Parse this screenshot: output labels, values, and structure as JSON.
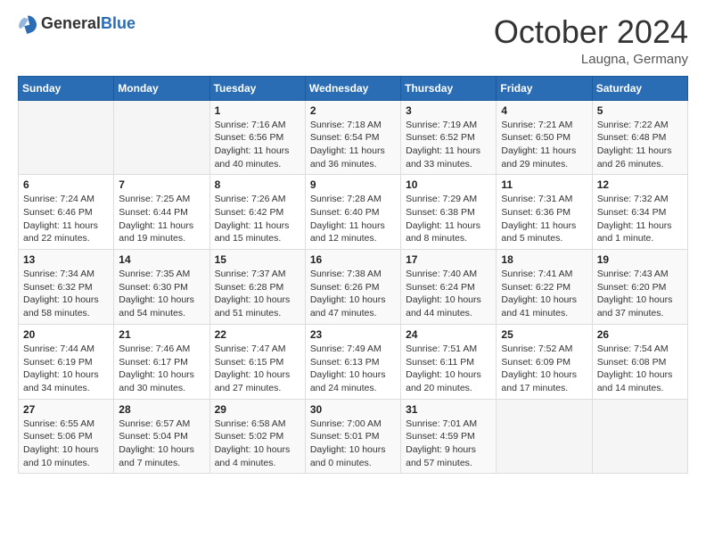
{
  "logo": {
    "general": "General",
    "blue": "Blue"
  },
  "title": "October 2024",
  "location": "Laugna, Germany",
  "days_of_week": [
    "Sunday",
    "Monday",
    "Tuesday",
    "Wednesday",
    "Thursday",
    "Friday",
    "Saturday"
  ],
  "weeks": [
    [
      {
        "day": "",
        "sunrise": "",
        "sunset": "",
        "daylight": "",
        "empty": true
      },
      {
        "day": "",
        "sunrise": "",
        "sunset": "",
        "daylight": "",
        "empty": true
      },
      {
        "day": "1",
        "sunrise": "Sunrise: 7:16 AM",
        "sunset": "Sunset: 6:56 PM",
        "daylight": "Daylight: 11 hours and 40 minutes."
      },
      {
        "day": "2",
        "sunrise": "Sunrise: 7:18 AM",
        "sunset": "Sunset: 6:54 PM",
        "daylight": "Daylight: 11 hours and 36 minutes."
      },
      {
        "day": "3",
        "sunrise": "Sunrise: 7:19 AM",
        "sunset": "Sunset: 6:52 PM",
        "daylight": "Daylight: 11 hours and 33 minutes."
      },
      {
        "day": "4",
        "sunrise": "Sunrise: 7:21 AM",
        "sunset": "Sunset: 6:50 PM",
        "daylight": "Daylight: 11 hours and 29 minutes."
      },
      {
        "day": "5",
        "sunrise": "Sunrise: 7:22 AM",
        "sunset": "Sunset: 6:48 PM",
        "daylight": "Daylight: 11 hours and 26 minutes."
      }
    ],
    [
      {
        "day": "6",
        "sunrise": "Sunrise: 7:24 AM",
        "sunset": "Sunset: 6:46 PM",
        "daylight": "Daylight: 11 hours and 22 minutes."
      },
      {
        "day": "7",
        "sunrise": "Sunrise: 7:25 AM",
        "sunset": "Sunset: 6:44 PM",
        "daylight": "Daylight: 11 hours and 19 minutes."
      },
      {
        "day": "8",
        "sunrise": "Sunrise: 7:26 AM",
        "sunset": "Sunset: 6:42 PM",
        "daylight": "Daylight: 11 hours and 15 minutes."
      },
      {
        "day": "9",
        "sunrise": "Sunrise: 7:28 AM",
        "sunset": "Sunset: 6:40 PM",
        "daylight": "Daylight: 11 hours and 12 minutes."
      },
      {
        "day": "10",
        "sunrise": "Sunrise: 7:29 AM",
        "sunset": "Sunset: 6:38 PM",
        "daylight": "Daylight: 11 hours and 8 minutes."
      },
      {
        "day": "11",
        "sunrise": "Sunrise: 7:31 AM",
        "sunset": "Sunset: 6:36 PM",
        "daylight": "Daylight: 11 hours and 5 minutes."
      },
      {
        "day": "12",
        "sunrise": "Sunrise: 7:32 AM",
        "sunset": "Sunset: 6:34 PM",
        "daylight": "Daylight: 11 hours and 1 minute."
      }
    ],
    [
      {
        "day": "13",
        "sunrise": "Sunrise: 7:34 AM",
        "sunset": "Sunset: 6:32 PM",
        "daylight": "Daylight: 10 hours and 58 minutes."
      },
      {
        "day": "14",
        "sunrise": "Sunrise: 7:35 AM",
        "sunset": "Sunset: 6:30 PM",
        "daylight": "Daylight: 10 hours and 54 minutes."
      },
      {
        "day": "15",
        "sunrise": "Sunrise: 7:37 AM",
        "sunset": "Sunset: 6:28 PM",
        "daylight": "Daylight: 10 hours and 51 minutes."
      },
      {
        "day": "16",
        "sunrise": "Sunrise: 7:38 AM",
        "sunset": "Sunset: 6:26 PM",
        "daylight": "Daylight: 10 hours and 47 minutes."
      },
      {
        "day": "17",
        "sunrise": "Sunrise: 7:40 AM",
        "sunset": "Sunset: 6:24 PM",
        "daylight": "Daylight: 10 hours and 44 minutes."
      },
      {
        "day": "18",
        "sunrise": "Sunrise: 7:41 AM",
        "sunset": "Sunset: 6:22 PM",
        "daylight": "Daylight: 10 hours and 41 minutes."
      },
      {
        "day": "19",
        "sunrise": "Sunrise: 7:43 AM",
        "sunset": "Sunset: 6:20 PM",
        "daylight": "Daylight: 10 hours and 37 minutes."
      }
    ],
    [
      {
        "day": "20",
        "sunrise": "Sunrise: 7:44 AM",
        "sunset": "Sunset: 6:19 PM",
        "daylight": "Daylight: 10 hours and 34 minutes."
      },
      {
        "day": "21",
        "sunrise": "Sunrise: 7:46 AM",
        "sunset": "Sunset: 6:17 PM",
        "daylight": "Daylight: 10 hours and 30 minutes."
      },
      {
        "day": "22",
        "sunrise": "Sunrise: 7:47 AM",
        "sunset": "Sunset: 6:15 PM",
        "daylight": "Daylight: 10 hours and 27 minutes."
      },
      {
        "day": "23",
        "sunrise": "Sunrise: 7:49 AM",
        "sunset": "Sunset: 6:13 PM",
        "daylight": "Daylight: 10 hours and 24 minutes."
      },
      {
        "day": "24",
        "sunrise": "Sunrise: 7:51 AM",
        "sunset": "Sunset: 6:11 PM",
        "daylight": "Daylight: 10 hours and 20 minutes."
      },
      {
        "day": "25",
        "sunrise": "Sunrise: 7:52 AM",
        "sunset": "Sunset: 6:09 PM",
        "daylight": "Daylight: 10 hours and 17 minutes."
      },
      {
        "day": "26",
        "sunrise": "Sunrise: 7:54 AM",
        "sunset": "Sunset: 6:08 PM",
        "daylight": "Daylight: 10 hours and 14 minutes."
      }
    ],
    [
      {
        "day": "27",
        "sunrise": "Sunrise: 6:55 AM",
        "sunset": "Sunset: 5:06 PM",
        "daylight": "Daylight: 10 hours and 10 minutes."
      },
      {
        "day": "28",
        "sunrise": "Sunrise: 6:57 AM",
        "sunset": "Sunset: 5:04 PM",
        "daylight": "Daylight: 10 hours and 7 minutes."
      },
      {
        "day": "29",
        "sunrise": "Sunrise: 6:58 AM",
        "sunset": "Sunset: 5:02 PM",
        "daylight": "Daylight: 10 hours and 4 minutes."
      },
      {
        "day": "30",
        "sunrise": "Sunrise: 7:00 AM",
        "sunset": "Sunset: 5:01 PM",
        "daylight": "Daylight: 10 hours and 0 minutes."
      },
      {
        "day": "31",
        "sunrise": "Sunrise: 7:01 AM",
        "sunset": "Sunset: 4:59 PM",
        "daylight": "Daylight: 9 hours and 57 minutes."
      },
      {
        "day": "",
        "sunrise": "",
        "sunset": "",
        "daylight": "",
        "empty": true
      },
      {
        "day": "",
        "sunrise": "",
        "sunset": "",
        "daylight": "",
        "empty": true
      }
    ]
  ]
}
